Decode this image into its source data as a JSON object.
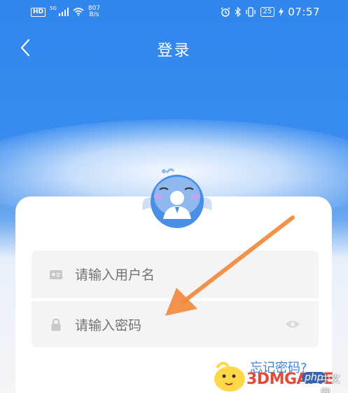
{
  "status_bar": {
    "hd": "HD",
    "network": "5G",
    "speed_value": "807",
    "speed_unit": "B/s",
    "battery": "25",
    "time": "07:57"
  },
  "header": {
    "title": "登录"
  },
  "form": {
    "username_placeholder": "请输入用户名",
    "password_placeholder": "请输入密码",
    "forgot_label": "忘记密码?"
  },
  "watermark": {
    "brand": "3DMGAME",
    "site_a": "php",
    "site_b": "中文网"
  },
  "colors": {
    "primary": "#2f86ec",
    "link": "#3c85e6",
    "arrow": "#f28a3c"
  },
  "icons": [
    "back-arrow-icon",
    "avatar-icon",
    "id-card-icon",
    "lock-icon",
    "eye-icon",
    "alarm-icon",
    "bluetooth-icon",
    "vibrate-icon",
    "wifi-icon",
    "signal-icon"
  ]
}
